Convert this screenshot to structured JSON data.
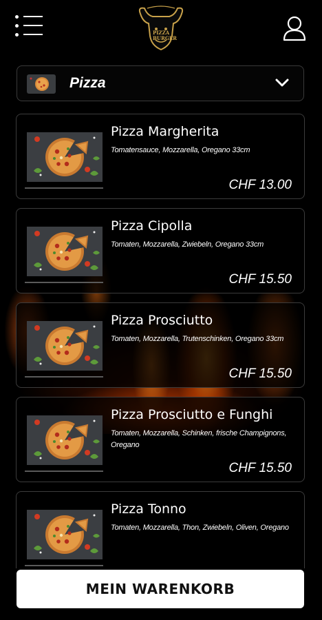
{
  "header": {
    "logo_text": [
      "PIZZA",
      "BURGER"
    ],
    "icons": {
      "menu": "menu-list-icon",
      "user": "user-profile-icon",
      "logo": "bull-head-logo"
    }
  },
  "category": {
    "label": "Pizza",
    "icon": "chevron-down-icon"
  },
  "products": [
    {
      "name": "Pizza Margherita",
      "description": "Tomatensauce, Mozzarella, Oregano 33cm",
      "price": "CHF 13.00"
    },
    {
      "name": "Pizza Cipolla",
      "description": "Tomaten, Mozzarella, Zwiebeln, Oregano 33cm",
      "price": "CHF 15.50"
    },
    {
      "name": "Pizza Prosciutto",
      "description": "Tomaten, Mozzarella, Trutenschinken, Oregano 33cm",
      "price": "CHF 15.50"
    },
    {
      "name": "Pizza Prosciutto e Funghi",
      "description": "Tomaten, Mozzarella, Schinken, frische Champignons, Oregano",
      "price": "CHF 15.50"
    },
    {
      "name": "Pizza Tonno",
      "description": "Tomaten, Mozzarella, Thon, Zwiebeln, Oliven, Oregano",
      "price": ""
    }
  ],
  "cart": {
    "label": "MEIN WARENKORB"
  },
  "colors": {
    "background": "#000000",
    "card_border": "#3c3c3c",
    "button_bg": "#ffffff",
    "logo_gold": "#c9a24a"
  }
}
